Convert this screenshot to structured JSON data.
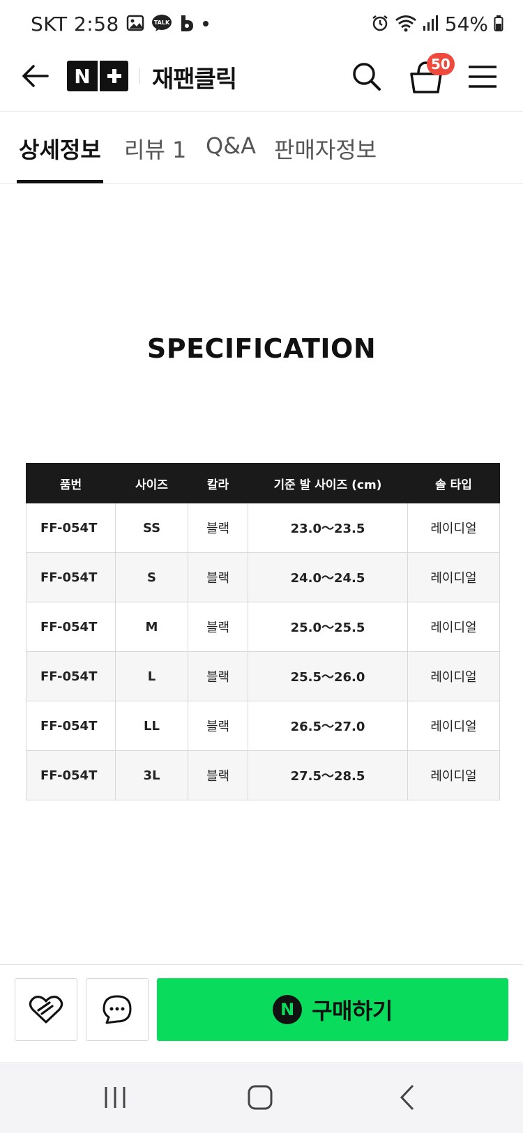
{
  "status_bar": {
    "carrier_time": "SKT 2:58",
    "battery": "54%"
  },
  "header": {
    "logo_text": "N",
    "store_name": "재팬클릭",
    "cart_count": "50"
  },
  "tabs": [
    {
      "label": "상세정보",
      "active": true
    },
    {
      "label": "리뷰 1",
      "active": false
    },
    {
      "label": "Q&A",
      "active": false
    },
    {
      "label": "판매자정보",
      "active": false
    }
  ],
  "content": {
    "title": "SPECIFICATION",
    "table": {
      "headers": [
        "품번",
        "사이즈",
        "칼라",
        "기준 발 사이즈 (cm)",
        "솔 타입"
      ],
      "rows": [
        [
          "FF-054T",
          "SS",
          "블랙",
          "23.0～23.5",
          "레이디얼"
        ],
        [
          "FF-054T",
          "S",
          "블랙",
          "24.0～24.5",
          "레이디얼"
        ],
        [
          "FF-054T",
          "M",
          "블랙",
          "25.0～25.5",
          "레이디얼"
        ],
        [
          "FF-054T",
          "L",
          "블랙",
          "25.5～26.0",
          "레이디얼"
        ],
        [
          "FF-054T",
          "LL",
          "블랙",
          "26.5～27.0",
          "레이디얼"
        ],
        [
          "FF-054T",
          "3L",
          "블랙",
          "27.5～28.5",
          "레이디얼"
        ]
      ]
    }
  },
  "bottom_bar": {
    "buy_icon_text": "N",
    "buy_label": "구매하기"
  },
  "colors": {
    "buy_green": "#09dc5c",
    "badge_red": "#f04a3e",
    "table_header": "#1a1a1a"
  }
}
